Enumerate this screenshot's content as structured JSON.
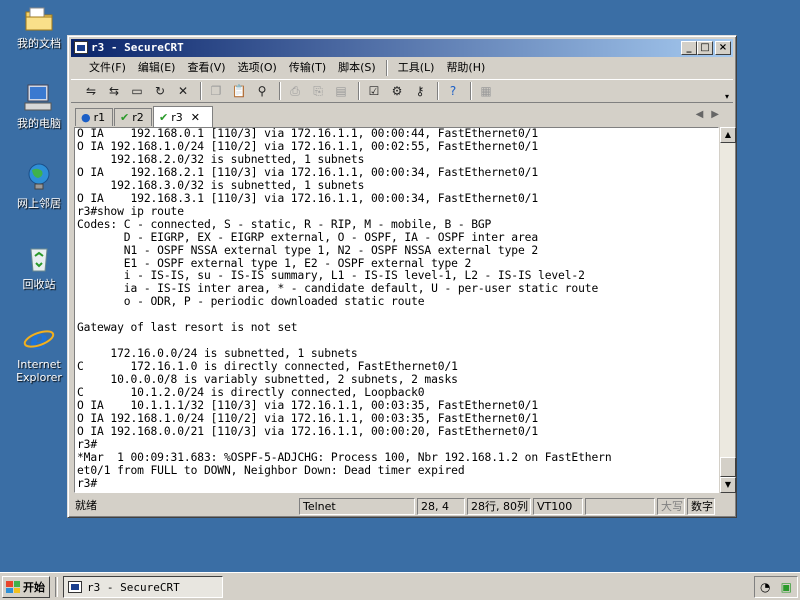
{
  "desktop": {
    "icons": [
      {
        "label": "我的文档",
        "icon": "folder-icon"
      },
      {
        "label": "我的电脑",
        "icon": "computer-icon"
      },
      {
        "label": "网上邻居",
        "icon": "network-icon"
      },
      {
        "label": "回收站",
        "icon": "recycle-bin-icon"
      },
      {
        "label": "Internet Explorer",
        "icon": "ie-icon"
      }
    ]
  },
  "window": {
    "title": "r3 - SecureCRT",
    "menu": [
      "文件(F)",
      "编辑(E)",
      "查看(V)",
      "选项(O)",
      "传输(T)",
      "脚本(S)",
      "工具(L)",
      "帮助(H)"
    ],
    "tabs": [
      {
        "label": "r1",
        "status": "info"
      },
      {
        "label": "r2",
        "status": "connected"
      },
      {
        "label": "r3",
        "status": "connected",
        "active": true
      }
    ],
    "terminal_lines": [
      "O IA    192.168.0.1 [110/3] via 172.16.1.1, 00:00:44, FastEthernet0/1",
      "O IA 192.168.1.0/24 [110/2] via 172.16.1.1, 00:02:55, FastEthernet0/1",
      "     192.168.2.0/32 is subnetted, 1 subnets",
      "O IA    192.168.2.1 [110/3] via 172.16.1.1, 00:00:34, FastEthernet0/1",
      "     192.168.3.0/32 is subnetted, 1 subnets",
      "O IA    192.168.3.1 [110/3] via 172.16.1.1, 00:00:34, FastEthernet0/1",
      "r3#show ip route",
      "Codes: C - connected, S - static, R - RIP, M - mobile, B - BGP",
      "       D - EIGRP, EX - EIGRP external, O - OSPF, IA - OSPF inter area",
      "       N1 - OSPF NSSA external type 1, N2 - OSPF NSSA external type 2",
      "       E1 - OSPF external type 1, E2 - OSPF external type 2",
      "       i - IS-IS, su - IS-IS summary, L1 - IS-IS level-1, L2 - IS-IS level-2",
      "       ia - IS-IS inter area, * - candidate default, U - per-user static route",
      "       o - ODR, P - periodic downloaded static route",
      "",
      "Gateway of last resort is not set",
      "",
      "     172.16.0.0/24 is subnetted, 1 subnets",
      "C       172.16.1.0 is directly connected, FastEthernet0/1",
      "     10.0.0.0/8 is variably subnetted, 2 subnets, 2 masks",
      "C       10.1.2.0/24 is directly connected, Loopback0",
      "O IA    10.1.1.1/32 [110/3] via 172.16.1.1, 00:03:35, FastEthernet0/1",
      "O IA 192.168.1.0/24 [110/2] via 172.16.1.1, 00:03:35, FastEthernet0/1",
      "O IA 192.168.0.0/21 [110/3] via 172.16.1.1, 00:00:20, FastEthernet0/1",
      "r3#",
      "*Mar  1 00:09:31.683: %OSPF-5-ADJCHG: Process 100, Nbr 192.168.1.2 on FastEthern",
      "et0/1 from FULL to DOWN, Neighbor Down: Dead timer expired",
      "r3#"
    ],
    "status": {
      "ready": "就绪",
      "protocol": "Telnet",
      "cursor": "28,  4",
      "size": "28行, 80列",
      "emulation": "VT100",
      "blank": "",
      "caps": "大写",
      "num": "数字"
    }
  },
  "taskbar": {
    "start_label": "开始",
    "task_label": "r3 - SecureCRT"
  },
  "colors": {
    "desktop": "#3a6ea5",
    "titlebar_start": "#0a246a",
    "titlebar_end": "#a6caf0"
  }
}
